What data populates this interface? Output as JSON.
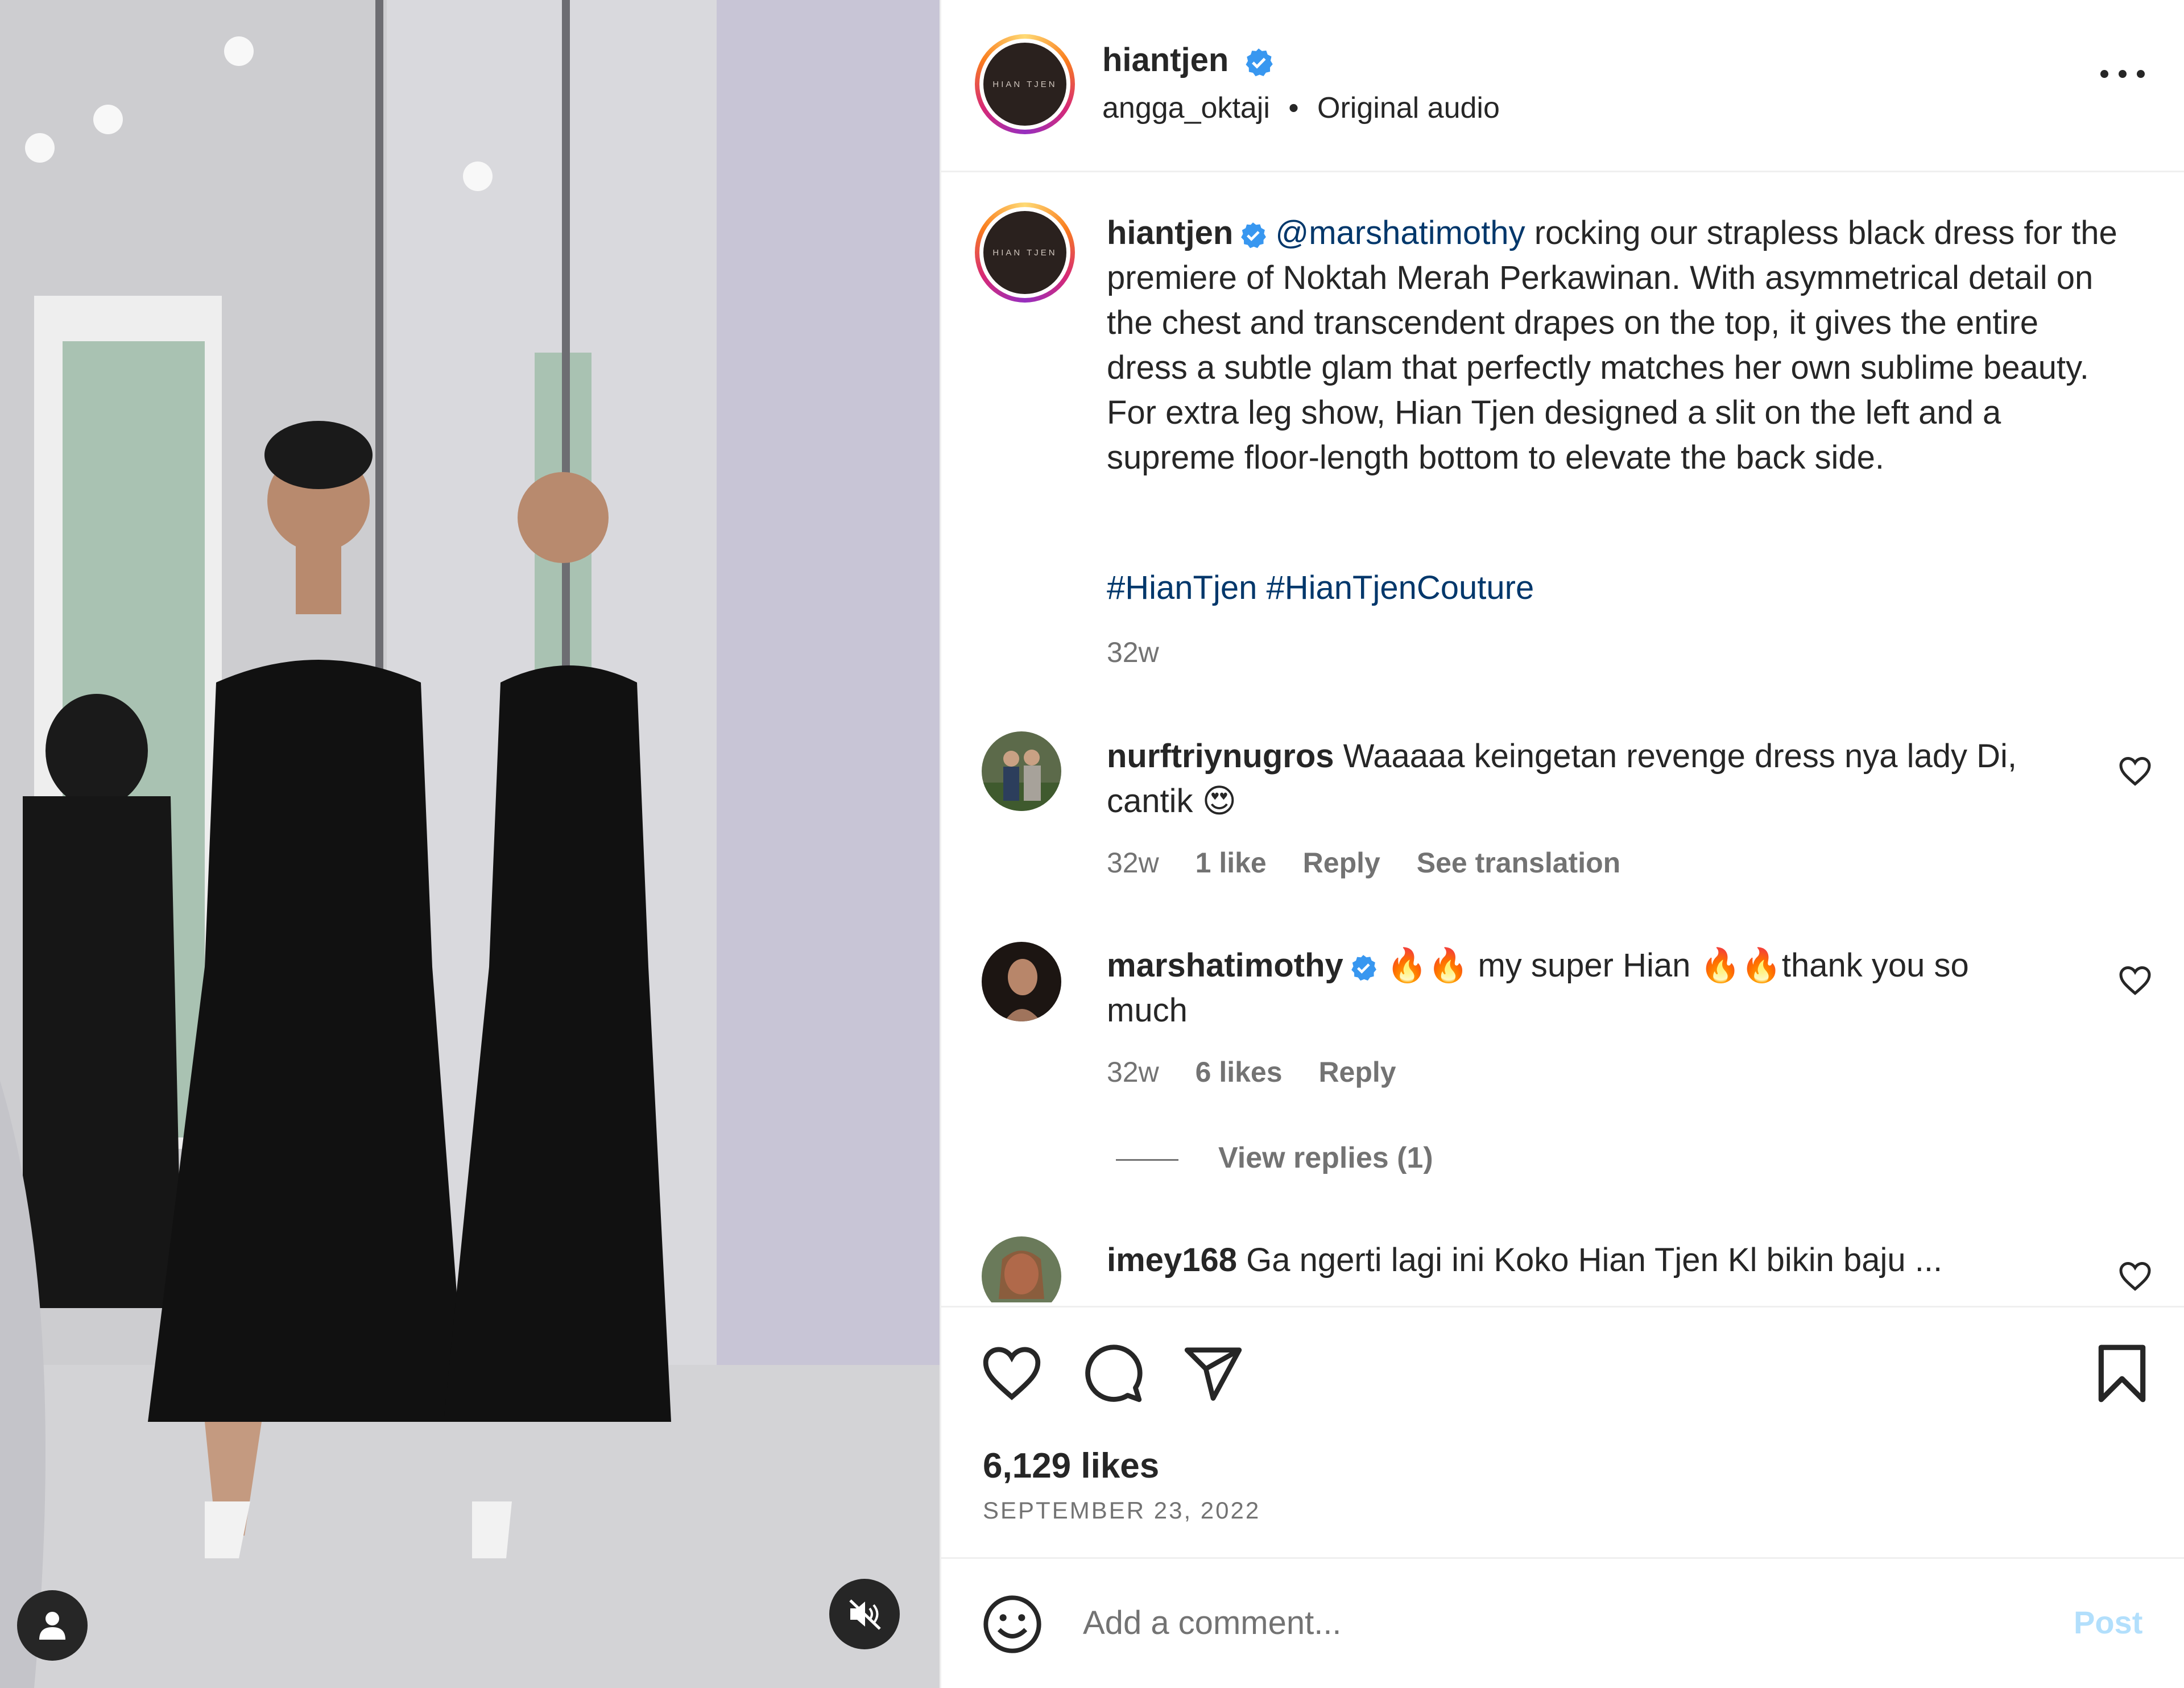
{
  "post": {
    "author": "hiantjen",
    "audio_user": "angga_oktaji",
    "audio_sep": "•",
    "audio_label": "Original audio",
    "logo_text": "HIAN TJEN",
    "caption_mention": "@marshatimothy",
    "caption_body": " rocking our strapless black dress for the premiere of Noktah Merah Perkawinan. With asymmetrical detail on the chest and transcendent drapes on the top, it gives the entire dress a subtle glam that perfectly matches her own sublime beauty. For extra leg show, Hian Tjen designed a slit on the left and a supreme floor-length bottom to elevate the back side.",
    "hashtags": "#HianTjen #HianTjenCouture",
    "caption_time": "32w",
    "likes": "6,129 likes",
    "date": "SEPTEMBER 23, 2022"
  },
  "comments": [
    {
      "user": "nurftriynugros",
      "text": " Waaaaa keingetan revenge dress nya lady Di, cantik 😍",
      "time": "32w",
      "likes": "1 like",
      "reply": "Reply",
      "translate": "See translation"
    },
    {
      "user": "marshatimothy",
      "text": " 🔥🔥 my super Hian 🔥🔥thank you so much",
      "time": "32w",
      "likes": "6 likes",
      "reply": "Reply",
      "view_replies": "View replies (1)"
    },
    {
      "user": "imey168",
      "text": " Ga ngerti lagi ini Koko Hian Tjen Kl bikin baju ..."
    }
  ],
  "composer": {
    "placeholder": "Add a comment...",
    "post_label": "Post"
  },
  "icons": {
    "more": "more-options-icon",
    "verified": "verified-badge-icon",
    "like": "heart-icon",
    "comment": "comment-icon",
    "share": "send-icon",
    "save": "bookmark-icon",
    "emoji": "emoji-icon",
    "user": "user-tag-icon",
    "mute": "muted-speaker-icon"
  },
  "colors": {
    "link": "#00376b",
    "verified": "#3897f0",
    "muted_text": "#737373",
    "post_disabled": "#b2dffc"
  }
}
